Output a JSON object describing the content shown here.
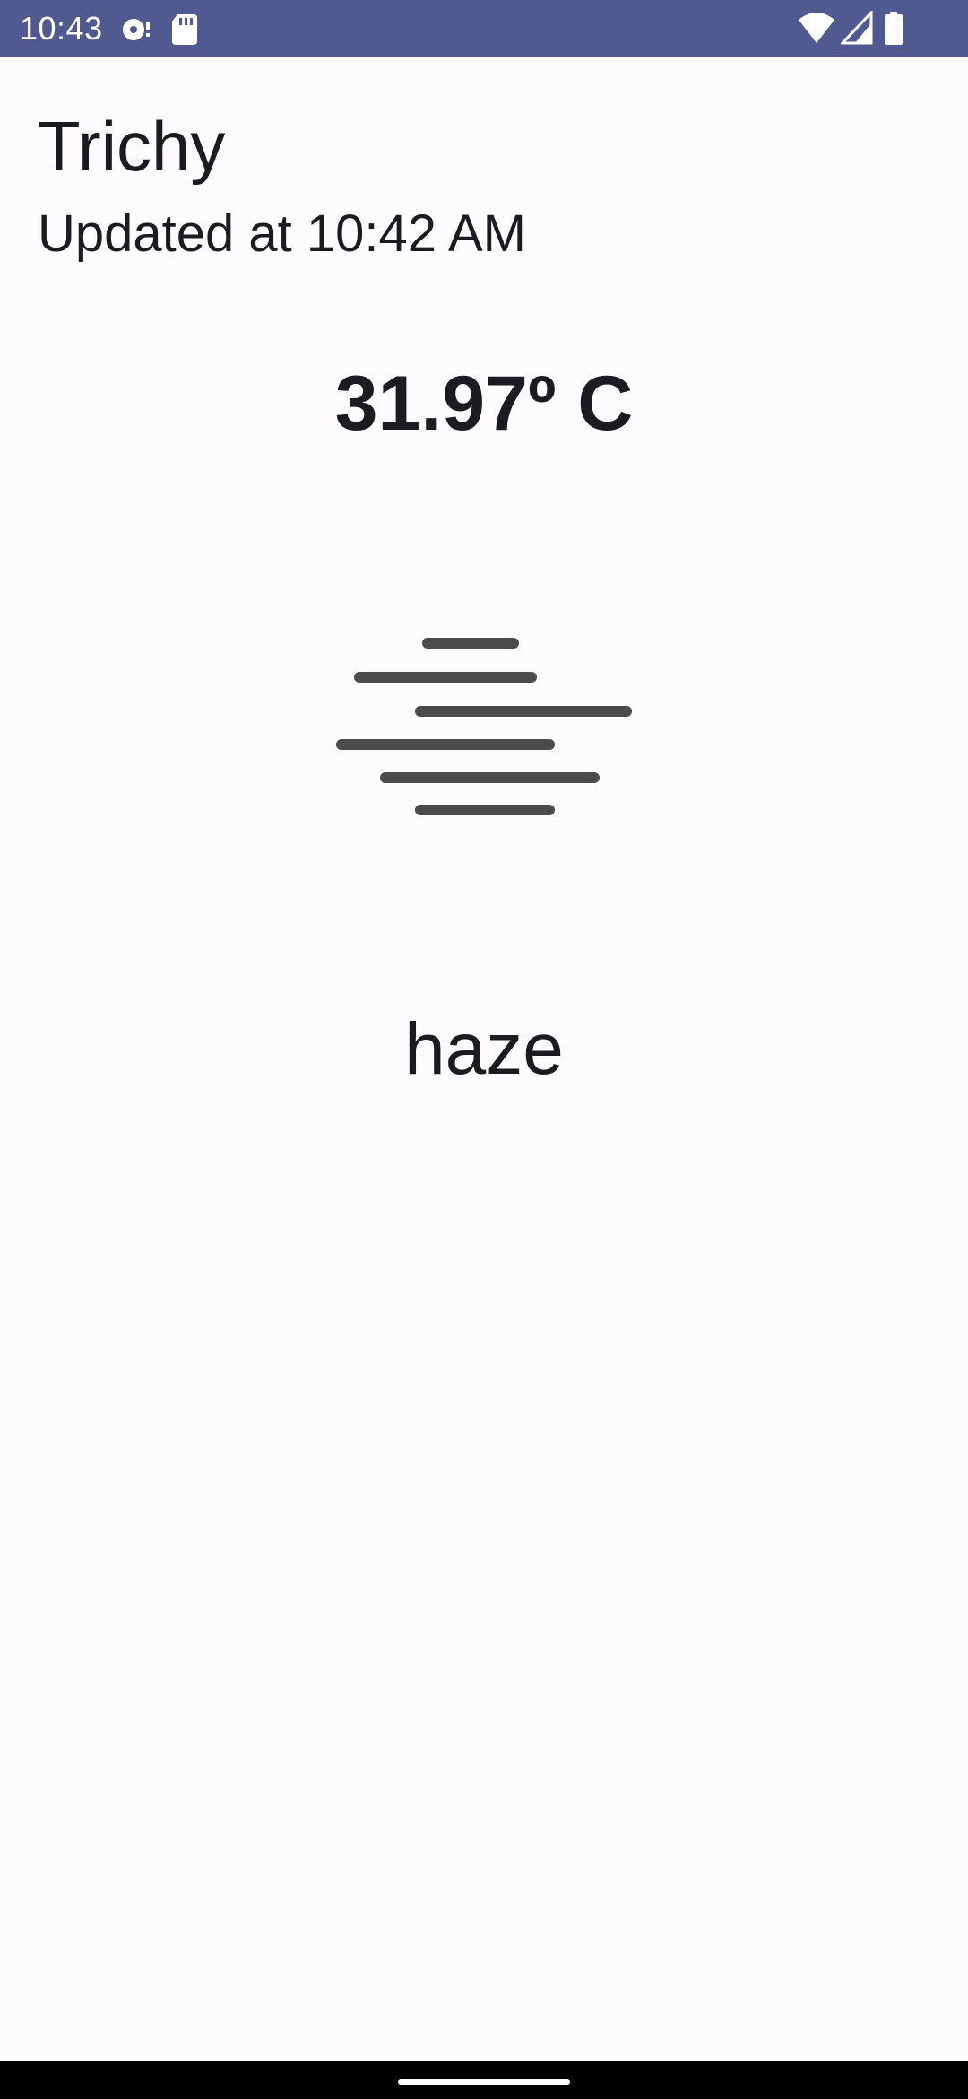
{
  "status_bar": {
    "time": "10:43",
    "background_color": "#505a91",
    "icons": [
      "sync-icon",
      "sd-card-icon",
      "wifi-icon",
      "signal-icon",
      "battery-icon"
    ]
  },
  "weather": {
    "city": "Trichy",
    "updated": "Updated at 10:42 AM",
    "temperature": "31.97º C",
    "condition_icon": "haze-icon",
    "condition": "haze"
  },
  "navigation": {
    "handle": "gesture-handle"
  }
}
